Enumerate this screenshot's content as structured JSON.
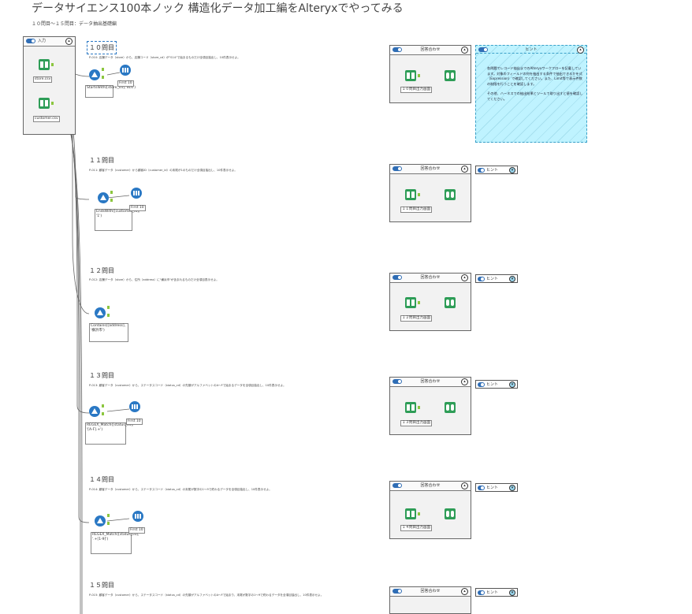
{
  "page": {
    "title": "データサイエンス100本ノック 構造化データ加工編をAlteryxでやってみる",
    "subtitle": "１０問目～１５問目：データ抽出基礎編"
  },
  "input_container": {
    "title": "入力",
    "tools": [
      {
        "name": "store-input",
        "annotation": "store.csv"
      },
      {
        "name": "customer-input",
        "annotation": "customer.csv"
      }
    ]
  },
  "questions": [
    {
      "number": "１０問目",
      "description": "P-010: 店舗データ（store）から、店舗コード（store_cd）が\"S14\"で始まるものだけ全項目抽出し、10件表示せよ。",
      "filter_annotation": "StartsWith([store_cd],'S14')",
      "sample_annotation": "First 10",
      "answer_container": {
        "title": "回答合わせ",
        "answer_label": "１０問目出力画面"
      },
      "hint": {
        "label": "ヒント",
        "expanded": true,
        "paragraphs": [
          "各問題でレコード抽出までのAlteryxワークフローを記載しています。対象のフィールドの何を抽出する条件で抽出できるかを式（Expression）で確認してください。また、Limit等で表示件数の制限を行うことを確認します。",
          "その他、ハーネスでの抽出結果とツールで取り出すと値を確認してください。"
        ]
      }
    },
    {
      "number": "１１問目",
      "description": "P-011: 顧客データ（customer）から顧客ID（customer_id）の末尾が1のものだけ全項目抽出し、10件表示せよ。",
      "filter_annotation": "EndsWith([customer_id], '1')",
      "sample_annotation": "First 10",
      "answer_container": {
        "title": "回答合わせ",
        "answer_label": "１１問目出力画面"
      },
      "hint": {
        "label": "ヒント",
        "expanded": false
      }
    },
    {
      "number": "１２問目",
      "description": "P-012: 店舗データ（store）から、住所（address）に\"横浜市\"が含まれるものだけ全項目表示せよ。",
      "filter_annotation": "Contains([address], '横浜市')",
      "sample_annotation": "",
      "answer_container": {
        "title": "回答合わせ",
        "answer_label": "１２問目出力画面"
      },
      "hint": {
        "label": "ヒント",
        "expanded": false
      }
    },
    {
      "number": "１３問目",
      "description": "P-013: 顧客データ（customer）から、ステータスコード（status_cd）の先頭がアルファベットのA〜Fで始まるデータを全項目抽出し、10件表示せよ。",
      "filter_annotation": "REGEX_Match([status_cd], '[A-F].+')",
      "sample_annotation": "First 10",
      "answer_container": {
        "title": "回答合わせ",
        "answer_label": "１３問目出力画面"
      },
      "hint": {
        "label": "ヒント",
        "expanded": false
      }
    },
    {
      "number": "１４問目",
      "description": "P-014: 顧客データ（customer）から、ステータスコード（status_cd）の末尾が数字の1〜9で終わるデータを全項目抽出し、10件表示せよ。",
      "filter_annotation": "REGEX_Match([status_cd], '.+[1-9]')",
      "sample_annotation": "First 10",
      "answer_container": {
        "title": "回答合わせ",
        "answer_label": "１４問目出力画面"
      },
      "hint": {
        "label": "ヒント",
        "expanded": false
      }
    },
    {
      "number": "１５問目",
      "description": "P-015: 顧客データ（customer）から、ステータスコード（status_cd）の先頭がアルファベットのA〜Fで始まり、末尾が数字の1〜9で終わるデータを全項目抽出し、10件表示せよ。",
      "filter_annotation": "",
      "sample_annotation": "",
      "answer_container": {
        "title": "回答合わせ",
        "answer_label": ""
      },
      "hint": {
        "label": "ヒント",
        "expanded": false
      }
    }
  ],
  "colors": {
    "toggle": "#2f6db5",
    "hint_fill": "#bff3ff",
    "anchor": "#8cc63f",
    "tool_green": "#2e9d57",
    "tool_blue": "#2a78c4"
  }
}
